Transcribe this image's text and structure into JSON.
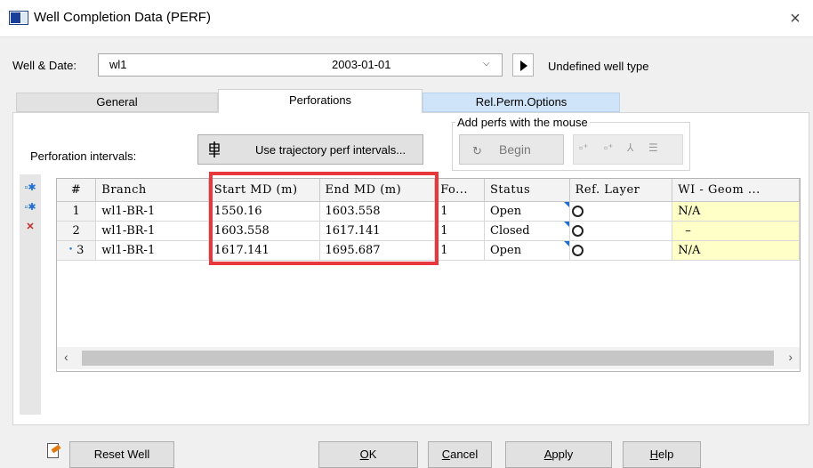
{
  "window": {
    "title": "Well Completion Data (PERF)",
    "close_glyph": "×"
  },
  "well_row": {
    "label": "Well & Date:",
    "well": "wl1",
    "date": "2003-01-01",
    "combo_arrow": "⌵",
    "well_type": "Undefined well type"
  },
  "tabs": [
    {
      "label": "General",
      "active": false
    },
    {
      "label": "Perforations",
      "active": true
    },
    {
      "label": "Rel.Perm.Options",
      "active": false
    }
  ],
  "perforations": {
    "intervals_label": "Perforation intervals:",
    "trajectory_button": "Use trajectory perf intervals...",
    "mouse_group_label": "Add perfs with the mouse",
    "begin_button": "Begin"
  },
  "grid": {
    "columns": [
      "#",
      "Branch",
      "Start MD (m)",
      "End MD (m)",
      "Fo...",
      "Status",
      "Ref. Layer",
      "WI - Geom ..."
    ],
    "rows": [
      {
        "num": "1",
        "branch": "wl1-BR-1",
        "start_md": "1550.16",
        "end_md": "1603.558",
        "fo": "1",
        "status": "Open",
        "ref_layer": "",
        "wi": "N/A"
      },
      {
        "num": "2",
        "branch": "wl1-BR-1",
        "start_md": "1603.558",
        "end_md": "1617.141",
        "fo": "1",
        "status": "Closed",
        "ref_layer": "",
        "wi": "–"
      },
      {
        "num": "3",
        "branch": "wl1-BR-1",
        "start_md": "1617.141",
        "end_md": "1695.687",
        "fo": "1",
        "status": "Open",
        "ref_layer": "",
        "wi": "N/A"
      }
    ],
    "current_row_marker": "•"
  },
  "footer": {
    "reset_well": "Reset Well",
    "ok_prefix": "",
    "ok_underlined": "O",
    "ok_rest": "K",
    "cancel_prefix": "",
    "cancel_underlined": "C",
    "cancel_rest": "ancel",
    "apply_prefix": "",
    "apply_underlined": "A",
    "apply_rest": "pply",
    "help_prefix": "",
    "help_underlined": "H",
    "help_rest": "elp"
  },
  "colors": {
    "highlight_box": "#e8383d",
    "rel_perm_tab": "#cfe4f8",
    "wi_cell": "#ffffc8"
  },
  "icons": [
    "app-icon",
    "close-icon",
    "play-icon",
    "trajectory-icon",
    "begin-hand-icon",
    "add-perf-icon",
    "insert-perf-icon",
    "delete-perf-icon",
    "save-edit-icon"
  ]
}
